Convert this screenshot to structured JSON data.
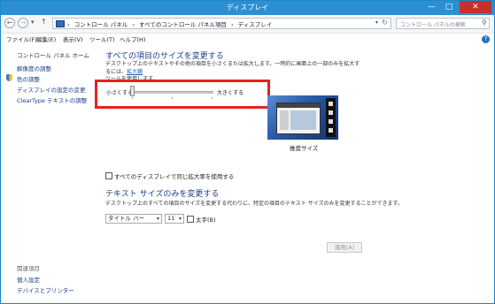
{
  "window": {
    "title": "ディスプレイ",
    "min_icon": "—",
    "max_icon": "□",
    "close_icon": "✕"
  },
  "nav": {
    "back_icon": "←",
    "forward_icon": "→",
    "recent_icon": "▾",
    "up_icon": "↑"
  },
  "address": {
    "crumbs": [
      "›",
      "コントロール パネル",
      "›",
      "すべてのコントロール パネル項目",
      "›",
      "ディスプレイ"
    ],
    "dropdown_icon": "▾",
    "refresh_icon": "↻"
  },
  "search": {
    "placeholder": "コントロール パネルの検索",
    "icon": "⚲"
  },
  "menu": {
    "file": "ファイル(F)",
    "edit": "編集(E)",
    "view": "表示(V)",
    "tools": "ツール(T)",
    "help": "ヘルプ(H)"
  },
  "help_icon": "?",
  "sidebar": {
    "home": "コントロール パネル ホーム",
    "links": [
      "解像度の調整",
      "色の調整",
      "ディスプレイの設定の変更",
      "ClearType テキストの調整"
    ],
    "see_also_title": "関連項目",
    "see_also": [
      "個人設定",
      "デバイスとプリンター"
    ]
  },
  "main": {
    "heading": "すべての項目のサイズを変更する",
    "desc_line1": "デスクトップ上のテキストやその他の項目を小さくまたは拡大します。一時的に画面上の一部のみを拡大するには、",
    "desc_link": "拡大鏡",
    "desc_line2": "ツールを使用します。",
    "slider_small": "小さくする",
    "slider_large": "大きくする",
    "slider_value": 0,
    "preview_label": "推奨サイズ",
    "same_scale_checkbox": "すべてのディスプレイで同じ拡大率を使用する",
    "text_heading": "テキスト サイズのみを変更する",
    "text_desc": "デスクトップ上のすべての項目のサイズを変更する代わりに、特定の項目のテキスト サイズのみを変更することができます。",
    "element_select": "タイトル バー",
    "size_select": "11",
    "select_arrow": "▾",
    "bold_checkbox": "太字(B)",
    "apply_button": "適用(A)"
  }
}
